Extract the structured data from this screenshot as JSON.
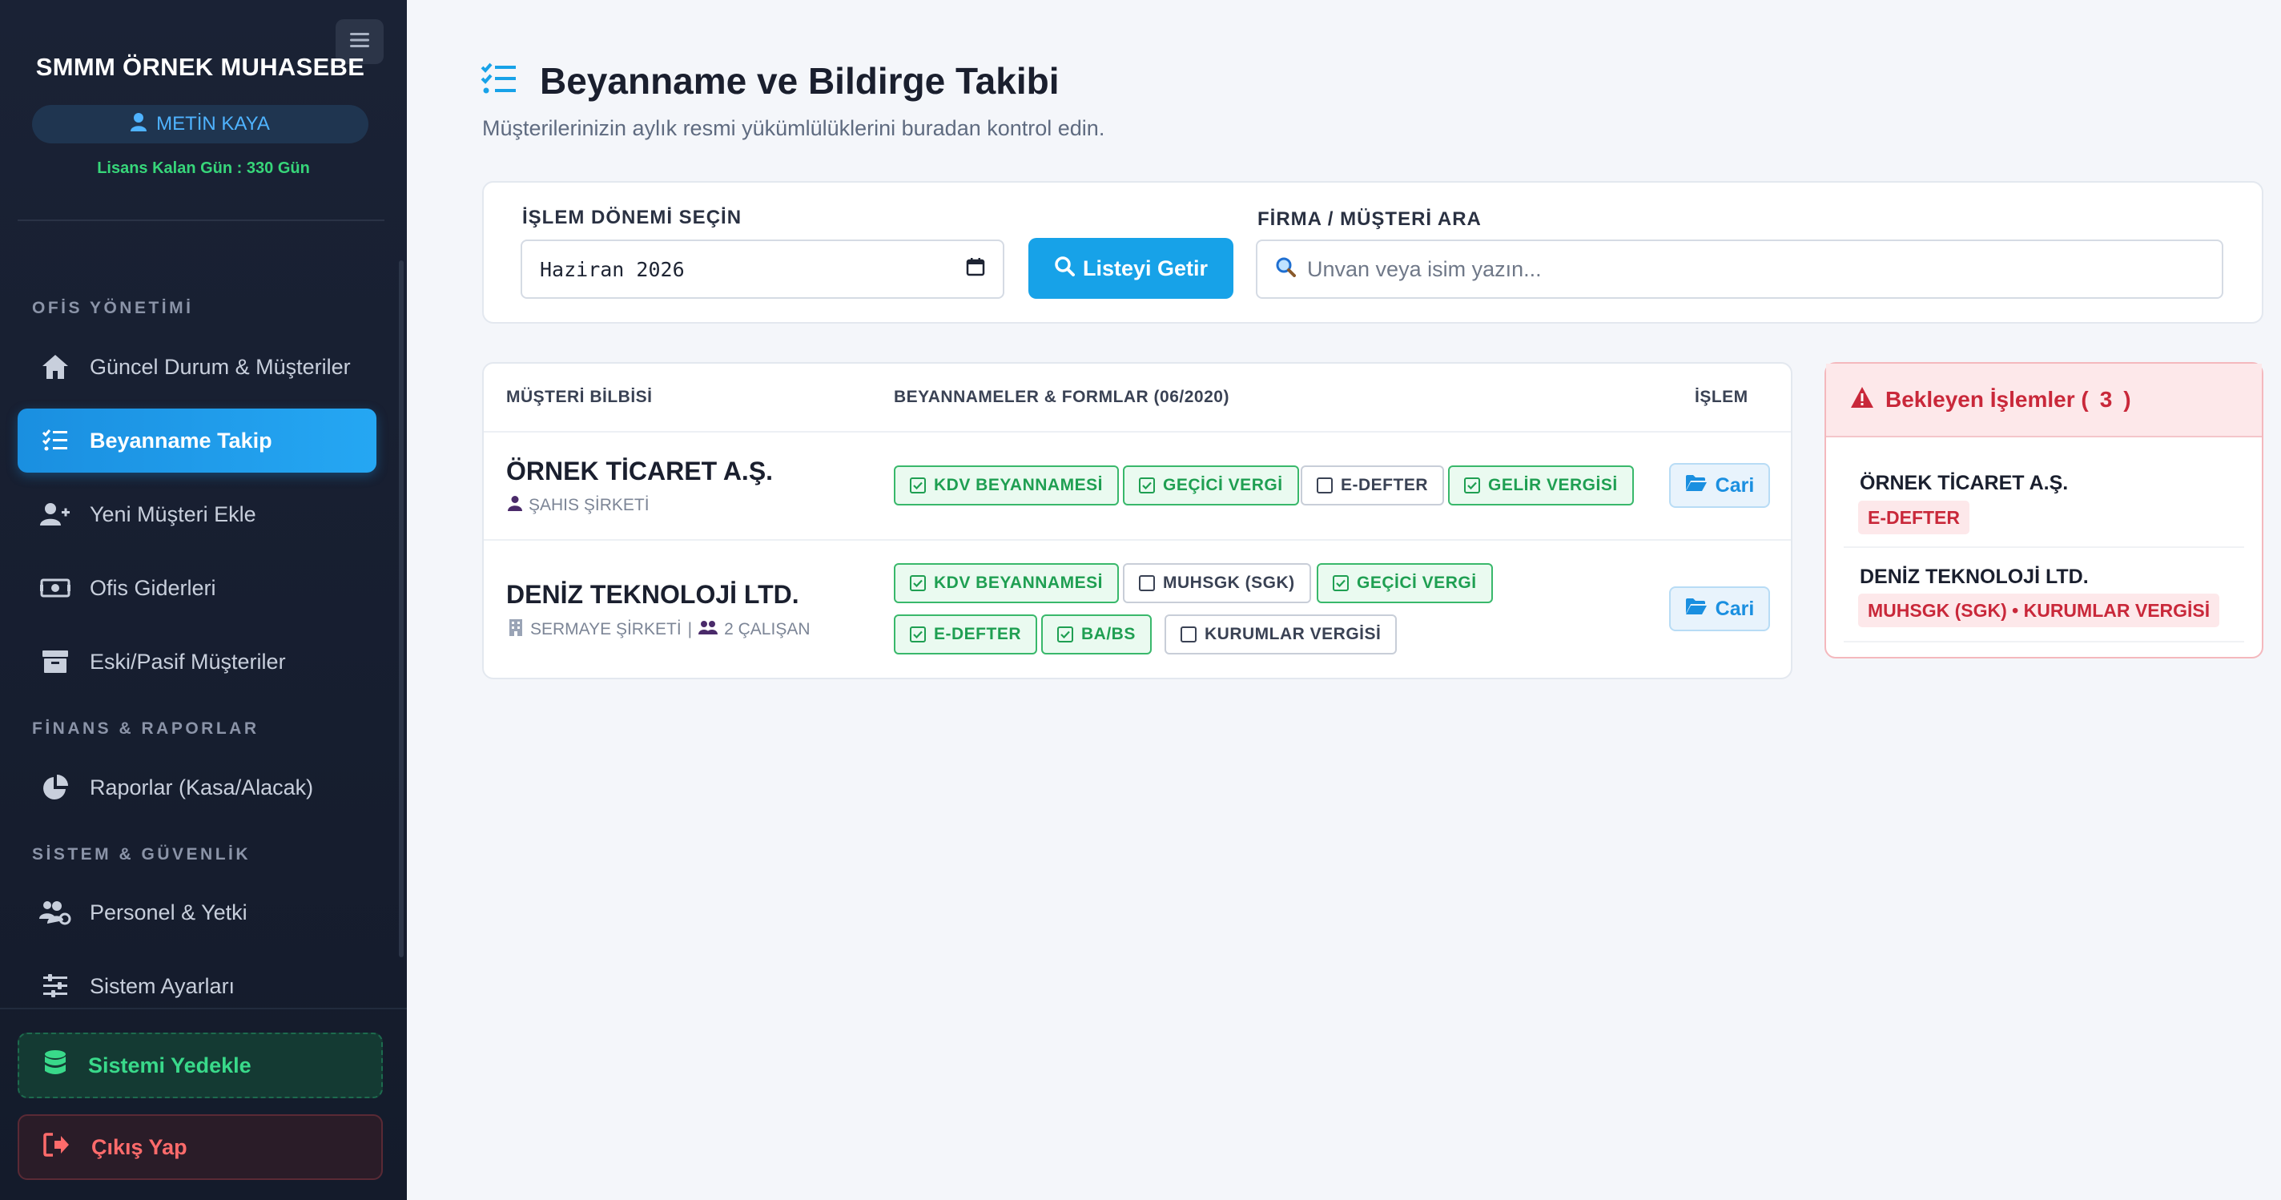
{
  "sidebar": {
    "brand": "SMMM ÖRNEK MUHASEBE",
    "user": "METİN KAYA",
    "license": "Lisans Kalan Gün : 330 Gün",
    "sections": [
      {
        "label": "OFİS YÖNETİMİ"
      },
      {
        "label": "FİNANS & RAPORLAR"
      },
      {
        "label": "SİSTEM & GÜVENLİK"
      }
    ],
    "items": [
      {
        "label": "Güncel Durum & Müşteriler",
        "icon": "home-icon"
      },
      {
        "label": "Beyanname Takip",
        "icon": "checklist-icon",
        "active": true
      },
      {
        "label": "Yeni Müşteri Ekle",
        "icon": "user-plus-icon"
      },
      {
        "label": "Ofis Giderleri",
        "icon": "money-icon"
      },
      {
        "label": "Eski/Pasif Müşteriler",
        "icon": "archive-icon"
      },
      {
        "label": "Raporlar (Kasa/Alacak)",
        "icon": "pie-chart-icon"
      },
      {
        "label": "Personel & Yetki",
        "icon": "users-gear-icon"
      },
      {
        "label": "Sistem Ayarları",
        "icon": "sliders-icon"
      }
    ],
    "backup": "Sistemi Yedekle",
    "logout": "Çıkış Yap"
  },
  "header": {
    "title": "Beyanname ve Bildirge Takibi",
    "subtitle": "Müşterilerinizin aylık resmi yükümlülüklerini buradan kontrol edin."
  },
  "filters": {
    "period_label": "İŞLEM DÖNEMİ SEÇİN",
    "period_value": "Haziran 2026",
    "fetch_label": "Listeyi Getir",
    "search_label": "FİRMA / MÜŞTERİ ARA",
    "search_placeholder": "Unvan veya isim yazın..."
  },
  "table": {
    "headers": [
      "MÜŞTERİ BİLBİSİ",
      "BEYANNAMELER & FORMLAR (06/2020)",
      "İŞLEM"
    ],
    "rows": [
      {
        "name": "ÖRNEK TİCARET A.Ş.",
        "type": "ŞAHIS ŞİRKETİ",
        "employees": "",
        "forms": [
          {
            "label": "KDV BEYANNAMESİ",
            "done": true
          },
          {
            "label": "GEÇİCİ VERGİ",
            "done": true
          },
          {
            "label": "E-DEFTER",
            "done": false
          },
          {
            "label": "GELİR VERGİSİ",
            "done": true
          }
        ],
        "action": "Cari"
      },
      {
        "name": "DENİZ TEKNOLOJİ LTD.",
        "type": "SERMAYE ŞİRKETİ",
        "employees": "2 ÇALIŞAN",
        "forms": [
          {
            "label": "KDV BEYANNAMESİ",
            "done": true
          },
          {
            "label": "MUHSGK (SGK)",
            "done": false
          },
          {
            "label": "GEÇİCİ VERGİ",
            "done": true
          },
          {
            "label": "E-DEFTER",
            "done": true
          },
          {
            "label": "BA/BS",
            "done": true
          },
          {
            "label": "KURUMLAR VERGİSİ",
            "done": false
          }
        ],
        "action": "Cari"
      }
    ]
  },
  "pending": {
    "title": "Bekleyen İşlemler (",
    "count": "3",
    "close": ")",
    "items": [
      {
        "name": "ÖRNEK TİCARET A.Ş.",
        "tag": "E-DEFTER"
      },
      {
        "name": "DENİZ TEKNOLOJİ LTD.",
        "tag": "MUHSGK (SGK) • KURUMLAR VERGİSİ"
      }
    ]
  },
  "colors": {
    "accent": "#17a2e8",
    "success": "#1f9f52",
    "danger": "#c9283a",
    "sidebar_bg": "#1a2235"
  }
}
